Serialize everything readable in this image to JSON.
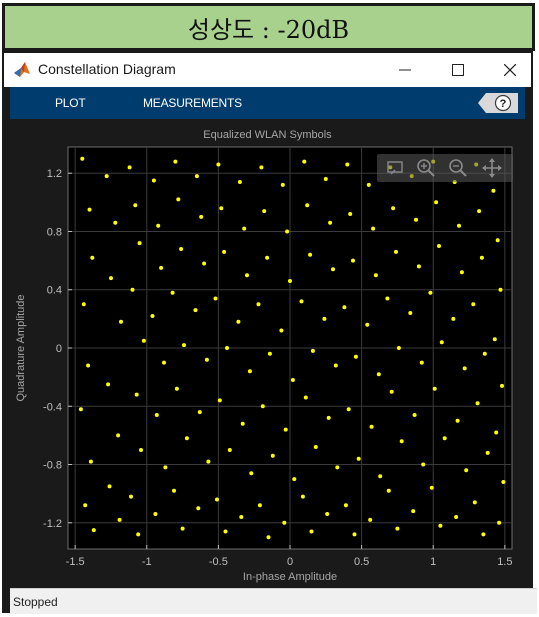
{
  "banner": {
    "text": "성상도 : -20dB"
  },
  "window": {
    "title": "Constellation Diagram",
    "controls": [
      "minimize-icon",
      "maximize-icon",
      "close-icon"
    ]
  },
  "toolstrip": {
    "tabs": [
      {
        "label": "PLOT"
      },
      {
        "label": "MEASUREMENTS"
      }
    ],
    "help_icon": "help-icon",
    "background": "#003d6e"
  },
  "axes_toolbar": {
    "tools": [
      "data-cursor-icon",
      "zoom-in-icon",
      "zoom-out-icon",
      "pan-icon"
    ]
  },
  "status": {
    "text": "Stopped"
  },
  "chart_data": {
    "type": "scatter",
    "title": "Equalized WLAN Symbols",
    "xlabel": "In-phase Amplitude",
    "ylabel": "Quadrature Amplitude",
    "xlim": [
      -1.55,
      1.55
    ],
    "ylim": [
      -1.38,
      1.38
    ],
    "xticks": [
      -1.5,
      -1,
      -0.5,
      0,
      0.5,
      1,
      1.5
    ],
    "xtick_labels": [
      "-1.5",
      "-1",
      "-0.5",
      "0",
      "0.5",
      "1",
      "1.5"
    ],
    "yticks": [
      -1.2,
      -0.8,
      -0.4,
      0,
      0.4,
      0.8,
      1.2
    ],
    "ytick_labels": [
      "-1.2",
      "-0.8",
      "-0.4",
      "0",
      "0.4",
      "0.8",
      "1.2"
    ],
    "grid": true,
    "background": "#000000",
    "marker_color": "#ffff00",
    "series": [
      {
        "points": [
          [
            -1.45,
            1.3
          ],
          [
            -1.4,
            0.95
          ],
          [
            -1.38,
            0.62
          ],
          [
            -1.44,
            0.3
          ],
          [
            -1.41,
            -0.12
          ],
          [
            -1.46,
            -0.42
          ],
          [
            -1.39,
            -0.78
          ],
          [
            -1.43,
            -1.08
          ],
          [
            -1.37,
            -1.25
          ],
          [
            -1.28,
            1.18
          ],
          [
            -1.22,
            0.86
          ],
          [
            -1.25,
            0.48
          ],
          [
            -1.18,
            0.18
          ],
          [
            -1.27,
            -0.25
          ],
          [
            -1.2,
            -0.6
          ],
          [
            -1.26,
            -0.95
          ],
          [
            -1.19,
            -1.18
          ],
          [
            -1.12,
            1.24
          ],
          [
            -1.08,
            0.98
          ],
          [
            -1.05,
            0.72
          ],
          [
            -1.1,
            0.4
          ],
          [
            -1.02,
            0.05
          ],
          [
            -1.07,
            -0.32
          ],
          [
            -1.04,
            -0.7
          ],
          [
            -1.11,
            -1.02
          ],
          [
            -1.06,
            -1.28
          ],
          [
            -0.95,
            1.15
          ],
          [
            -0.92,
            0.84
          ],
          [
            -0.9,
            0.55
          ],
          [
            -0.96,
            0.22
          ],
          [
            -0.88,
            -0.1
          ],
          [
            -0.93,
            -0.46
          ],
          [
            -0.87,
            -0.82
          ],
          [
            -0.94,
            -1.14
          ],
          [
            -0.8,
            1.28
          ],
          [
            -0.78,
            1.02
          ],
          [
            -0.76,
            0.68
          ],
          [
            -0.82,
            0.38
          ],
          [
            -0.74,
            0.02
          ],
          [
            -0.79,
            -0.28
          ],
          [
            -0.72,
            -0.62
          ],
          [
            -0.81,
            -0.98
          ],
          [
            -0.75,
            -1.24
          ],
          [
            -0.65,
            1.18
          ],
          [
            -0.62,
            0.9
          ],
          [
            -0.6,
            0.58
          ],
          [
            -0.66,
            0.26
          ],
          [
            -0.58,
            -0.08
          ],
          [
            -0.63,
            -0.44
          ],
          [
            -0.57,
            -0.78
          ],
          [
            -0.64,
            -1.1
          ],
          [
            -0.5,
            1.26
          ],
          [
            -0.48,
            0.96
          ],
          [
            -0.46,
            0.66
          ],
          [
            -0.52,
            0.34
          ],
          [
            -0.44,
            0.0
          ],
          [
            -0.49,
            -0.36
          ],
          [
            -0.42,
            -0.7
          ],
          [
            -0.51,
            -1.04
          ],
          [
            -0.45,
            -1.26
          ],
          [
            -0.35,
            1.14
          ],
          [
            -0.32,
            0.82
          ],
          [
            -0.3,
            0.5
          ],
          [
            -0.36,
            0.18
          ],
          [
            -0.28,
            -0.16
          ],
          [
            -0.33,
            -0.52
          ],
          [
            -0.27,
            -0.86
          ],
          [
            -0.34,
            -1.16
          ],
          [
            -0.2,
            1.24
          ],
          [
            -0.18,
            0.94
          ],
          [
            -0.16,
            0.62
          ],
          [
            -0.22,
            0.3
          ],
          [
            -0.14,
            -0.04
          ],
          [
            -0.19,
            -0.4
          ],
          [
            -0.12,
            -0.74
          ],
          [
            -0.21,
            -1.08
          ],
          [
            -0.15,
            -1.3
          ],
          [
            -0.05,
            1.12
          ],
          [
            -0.02,
            0.8
          ],
          [
            0.0,
            0.46
          ],
          [
            -0.06,
            0.12
          ],
          [
            0.02,
            -0.22
          ],
          [
            -0.03,
            -0.56
          ],
          [
            0.03,
            -0.9
          ],
          [
            -0.04,
            -1.2
          ],
          [
            0.1,
            1.28
          ],
          [
            0.12,
            0.98
          ],
          [
            0.14,
            0.64
          ],
          [
            0.08,
            0.32
          ],
          [
            0.16,
            -0.02
          ],
          [
            0.11,
            -0.34
          ],
          [
            0.18,
            -0.68
          ],
          [
            0.09,
            -1.02
          ],
          [
            0.15,
            -1.26
          ],
          [
            0.25,
            1.16
          ],
          [
            0.28,
            0.86
          ],
          [
            0.3,
            0.54
          ],
          [
            0.24,
            0.2
          ],
          [
            0.32,
            -0.12
          ],
          [
            0.27,
            -0.48
          ],
          [
            0.33,
            -0.82
          ],
          [
            0.26,
            -1.14
          ],
          [
            0.4,
            1.26
          ],
          [
            0.42,
            0.92
          ],
          [
            0.44,
            0.6
          ],
          [
            0.38,
            0.28
          ],
          [
            0.46,
            -0.06
          ],
          [
            0.41,
            -0.42
          ],
          [
            0.48,
            -0.76
          ],
          [
            0.39,
            -1.08
          ],
          [
            0.45,
            -1.28
          ],
          [
            0.55,
            1.12
          ],
          [
            0.58,
            0.82
          ],
          [
            0.6,
            0.5
          ],
          [
            0.54,
            0.16
          ],
          [
            0.62,
            -0.18
          ],
          [
            0.57,
            -0.54
          ],
          [
            0.63,
            -0.88
          ],
          [
            0.56,
            -1.18
          ],
          [
            0.7,
            1.24
          ],
          [
            0.72,
            0.96
          ],
          [
            0.74,
            0.66
          ],
          [
            0.68,
            0.34
          ],
          [
            0.76,
            0.0
          ],
          [
            0.71,
            -0.3
          ],
          [
            0.78,
            -0.64
          ],
          [
            0.69,
            -0.98
          ],
          [
            0.75,
            -1.24
          ],
          [
            0.85,
            1.18
          ],
          [
            0.88,
            0.88
          ],
          [
            0.9,
            0.56
          ],
          [
            0.84,
            0.24
          ],
          [
            0.92,
            -0.1
          ],
          [
            0.87,
            -0.46
          ],
          [
            0.93,
            -0.8
          ],
          [
            0.86,
            -1.12
          ],
          [
            1.0,
            1.28
          ],
          [
            1.02,
            1.0
          ],
          [
            1.04,
            0.7
          ],
          [
            0.98,
            0.38
          ],
          [
            1.06,
            0.04
          ],
          [
            1.01,
            -0.28
          ],
          [
            1.08,
            -0.62
          ],
          [
            0.99,
            -0.96
          ],
          [
            1.05,
            -1.22
          ],
          [
            1.15,
            1.14
          ],
          [
            1.18,
            0.84
          ],
          [
            1.2,
            0.52
          ],
          [
            1.14,
            0.2
          ],
          [
            1.22,
            -0.14
          ],
          [
            1.17,
            -0.5
          ],
          [
            1.23,
            -0.84
          ],
          [
            1.16,
            -1.16
          ],
          [
            1.3,
            1.26
          ],
          [
            1.32,
            0.94
          ],
          [
            1.34,
            0.62
          ],
          [
            1.28,
            0.3
          ],
          [
            1.36,
            -0.04
          ],
          [
            1.31,
            -0.38
          ],
          [
            1.38,
            -0.72
          ],
          [
            1.29,
            -1.06
          ],
          [
            1.35,
            -1.28
          ],
          [
            1.42,
            1.08
          ],
          [
            1.45,
            0.74
          ],
          [
            1.47,
            0.4
          ],
          [
            1.43,
            0.06
          ],
          [
            1.48,
            -0.26
          ],
          [
            1.44,
            -0.58
          ],
          [
            1.49,
            -0.92
          ],
          [
            1.46,
            -1.2
          ]
        ]
      }
    ]
  }
}
